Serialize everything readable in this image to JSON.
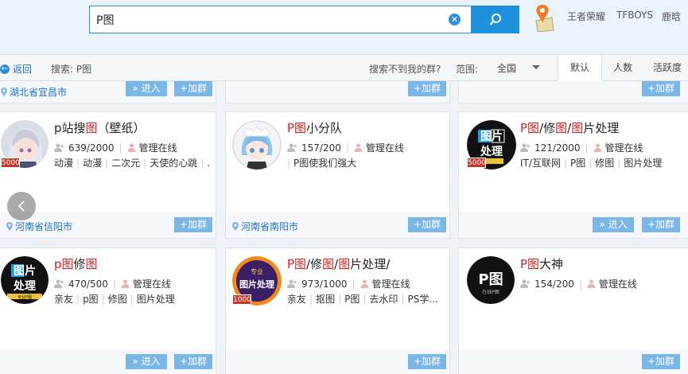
{
  "search": {
    "query": "P图",
    "clear_icon": "clear-icon",
    "button_icon": "search-icon"
  },
  "hot_tags": [
    "王者荣耀",
    "TFBOYS",
    "鹿晗"
  ],
  "toolbar": {
    "back_label": "返回",
    "search_label": "搜索: P图",
    "not_found_label": "搜索不到我的群?",
    "range_label": "范围:",
    "range_value": "全国",
    "sort_tabs": [
      "默认",
      "人数",
      "活跃度"
    ]
  },
  "buttons": {
    "enter": "» 进入",
    "join": "+加群"
  },
  "partial_row": {
    "location": "湖北省宜昌市"
  },
  "cards": [
    {
      "name_parts": [
        {
          "t": "p站搜",
          "h": false
        },
        {
          "t": "图",
          "h": true
        },
        {
          "t": "（壁纸）",
          "h": false
        }
      ],
      "members": "639/2000",
      "admin": "管理在线",
      "tags": [
        "动漫",
        "动漫",
        "二次元",
        "天使的心跳",
        "..."
      ],
      "location": "河南省信阳市",
      "badge": "5000"
    },
    {
      "name_parts": [
        {
          "t": "P图",
          "h": true
        },
        {
          "t": "小分队",
          "h": false
        }
      ],
      "members": "157/200",
      "admin": "管理在线",
      "tags": [
        "P图使我们强大"
      ],
      "location": "河南省南阳市",
      "badge": ""
    },
    {
      "name_parts": [
        {
          "t": "P图",
          "h": true
        },
        {
          "t": "/修",
          "h": false
        },
        {
          "t": "图",
          "h": true
        },
        {
          "t": "/",
          "h": false
        },
        {
          "t": "图",
          "h": true
        },
        {
          "t": "片处理",
          "h": false
        }
      ],
      "members": "121/2000",
      "admin": "管理在线",
      "tags": [
        "IT/互联网",
        "P图",
        "修图",
        "图片处理"
      ],
      "location": "",
      "badge": "5000"
    },
    {
      "name_parts": [
        {
          "t": "p图",
          "h": true
        },
        {
          "t": "修",
          "h": false
        },
        {
          "t": "图",
          "h": true
        }
      ],
      "members": "470/500",
      "admin": "管理在线",
      "tags": [
        "亲友",
        "p图",
        "修图",
        "图片处理"
      ],
      "location": "",
      "badge": ""
    },
    {
      "name_parts": [
        {
          "t": "P图",
          "h": true
        },
        {
          "t": "/修",
          "h": false
        },
        {
          "t": "图",
          "h": true
        },
        {
          "t": "/",
          "h": false
        },
        {
          "t": "图",
          "h": true
        },
        {
          "t": "片处理/",
          "h": false
        }
      ],
      "members": "973/1000",
      "admin": "管理在线",
      "tags": [
        "亲友",
        "抠图",
        "P图",
        "去水印",
        "PS学..."
      ],
      "location": "",
      "badge": "1000"
    },
    {
      "name_parts": [
        {
          "t": "P图",
          "h": true
        },
        {
          "t": "大神",
          "h": false
        }
      ],
      "members": "154/200",
      "admin": "管理在线",
      "tags": [],
      "location": "",
      "badge": ""
    }
  ],
  "avatar_texts": {
    "poster1": "图片",
    "poster2": "处理",
    "poster_small": "专业P图",
    "round_top": "专业",
    "logo_p": "P图",
    "logo_sub": "在线P图"
  },
  "colors": {
    "accent": "#1e90dc",
    "highlight": "#d42020",
    "button": "#7ab6e6",
    "link": "#1a73c8"
  }
}
